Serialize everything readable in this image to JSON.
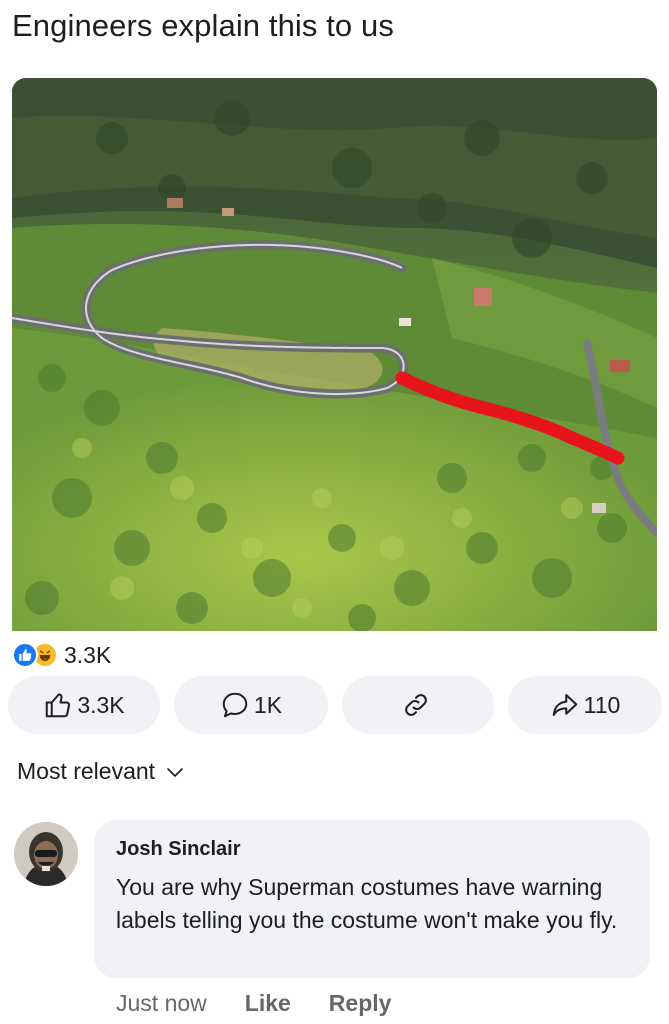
{
  "post": {
    "title": "Engineers explain this to us",
    "image_alt": "Aerial view of a hairpin mountain road with a red line drawn as a shortcut down the hillside"
  },
  "reactions": {
    "icons": [
      "like-icon",
      "haha-icon"
    ],
    "count": "3.3K",
    "like_color": "#1877f2",
    "haha_color": "#f7b928"
  },
  "actions": {
    "like_label": "3.3K",
    "comment_label": "1K",
    "link_label": "",
    "share_label": "110"
  },
  "comments": {
    "sort_label": "Most relevant",
    "items": [
      {
        "author": "Josh Sinclair",
        "text": "You are why Superman costumes have warning labels telling you the costume won't make you fly.",
        "time": "Just now",
        "like_label": "Like",
        "reply_label": "Reply"
      }
    ]
  },
  "colors": {
    "bubble_bg": "#f0f2f5",
    "secondary_text": "#65676b",
    "primary_text": "#1c1e21",
    "annotation_red": "#e8141c"
  }
}
